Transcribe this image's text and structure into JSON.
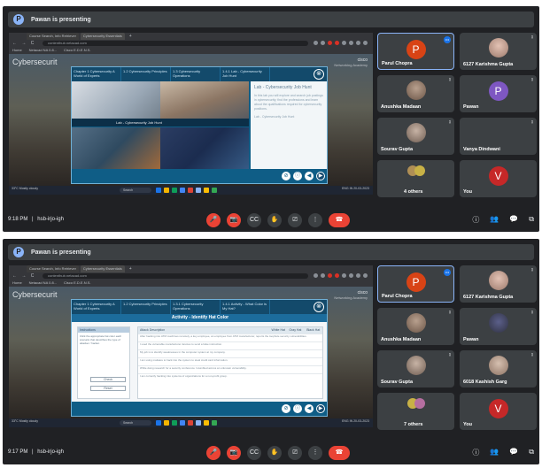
{
  "screens": [
    {
      "banner": {
        "icon": "P",
        "text": "Pawan is presenting"
      },
      "browser": {
        "tabs": [
          "Course Search, Info Retriever",
          "Cybersecurity Essentials"
        ],
        "new_tab": "+",
        "nav": "← → C",
        "address": "contenthub.netacad.com",
        "bookmarks": [
          "Home",
          "Netacad NA 0.8...",
          "Cisco E.D.E.N.S."
        ]
      },
      "site": {
        "title": "Cybersecurit",
        "cisco": "cisco",
        "cisco_sub": "Networking Academy"
      },
      "modal": {
        "chapters": [
          "Chapter 1\nCybersecurity A World of Experts",
          "1.2\nCybersecurity Principles",
          "1.3 Cybersecurity Operations",
          "1.4.1\nLab - Cybersecurity Job Hunt"
        ],
        "close": "⊗",
        "lab_strip": "Lab - Cybersecurity Job Hunt",
        "lab_title": "Lab - Cybersecurity Job Hunt",
        "lab_text": "In this lab you will explore and search job postings in cybersecurity; find the professions and learn about the qualifications required for cybersecurity positions.",
        "lab_link": "Lab - Cybersecurity Job Hunt",
        "footer_buttons": [
          "⊘",
          "ⓘ",
          "◀",
          "▶"
        ]
      },
      "taskbar": {
        "left": "33°C\nMostly cloudy",
        "search": "Search",
        "right": "ENG IN\n20-03-2023"
      },
      "participants": [
        {
          "name": "Parul Chopra",
          "letter": "P",
          "color": "#d84315",
          "type": "letter",
          "speaking": true
        },
        {
          "name": "6127 Karishma Gupta",
          "color": "#c9a69a",
          "type": "photo"
        },
        {
          "name": "Anushka Madaan",
          "color": "#8f7b6b",
          "type": "photo"
        },
        {
          "name": "Pawan",
          "letter": "P",
          "color": "#7e57c2",
          "type": "letter"
        },
        {
          "name": "Sourav Gupta",
          "color": "#a88f7e",
          "type": "photo"
        },
        {
          "name": "Vanya Dindwani",
          "color": "#3c4043",
          "type": "blank"
        },
        {
          "name": "4 others",
          "color": "#b08f55",
          "type": "others"
        },
        {
          "name": "You",
          "letter": "V",
          "color": "#c62828",
          "type": "letter"
        }
      ],
      "bottom": {
        "time": "9:18 PM",
        "separator": "|",
        "code": "hsb-irjo-igh"
      }
    },
    {
      "banner": {
        "icon": "P",
        "text": "Pawan is presenting"
      },
      "browser": {
        "tabs": [
          "Course Search, Info Retriever",
          "Cybersecurity Essentials"
        ],
        "new_tab": "+",
        "nav": "← → C",
        "address": "contenthub.netacad.com",
        "bookmarks": [
          "Home",
          "Netacad NA 0.8...",
          "Cisco E.D.E.N.S."
        ]
      },
      "site": {
        "title": "Cybersecurit",
        "cisco": "cisco",
        "cisco_sub": "Networking Academy"
      },
      "modal": {
        "chapters": [
          "Chapter 1\nCybersecurity A World of Experts",
          "1.2\nCybersecurity Principles",
          "1.3.1\nCybersecurity Operations",
          "1.4.1\nActivity - What Color is My Hat?"
        ],
        "close": "⊗",
        "activity_title": "Activity - Identify Hat Color",
        "instr_head": "Instructions",
        "instr_text": "Click the appropriate hat color each scenario that describes the type of attacker / hacker.",
        "left_buttons": [
          "Check",
          "Reset"
        ],
        "table_headers": [
          "Attack Description",
          "White Hat",
          "Gray Hat",
          "Black Hat"
        ],
        "table_rows": [
          "After hacking into ATM machines remotely, a key employee, an employee from ATM manufacturer, reports the loophole security vulnerabilities.",
          "I used the vulnerable manufacturer devices to send a false instruction.",
          "My job is to identify weaknesses in the computer system at my company.",
          "I am using malware to hack into the system to steal credit card information.",
          "While doing research for a security conference I stumbled across an unknown vulnerability.",
          "I am currently hacking into systems of organizations for a non-profit group."
        ],
        "footer_buttons": [
          "⊘",
          "ⓘ",
          "◀",
          "▶"
        ]
      },
      "taskbar": {
        "left": "33°C\nMostly cloudy",
        "search": "Search",
        "right": "ENG IN\n20-03-2023"
      },
      "participants": [
        {
          "name": "Parul Chopra",
          "letter": "P",
          "color": "#d84315",
          "type": "letter",
          "speaking": true
        },
        {
          "name": "6127 Karishma Gupta",
          "color": "#c9a69a",
          "type": "photo"
        },
        {
          "name": "Anushka Madaan",
          "color": "#8f7b6b",
          "type": "photo"
        },
        {
          "name": "Pawan",
          "color": "#5f6368",
          "type": "photo"
        },
        {
          "name": "Sourav Gupta",
          "color": "#a88f7e",
          "type": "photo"
        },
        {
          "name": "6018 Kashish Garg",
          "color": "#b59a8c",
          "type": "photo"
        },
        {
          "name": "7 others",
          "color": "#b56ea0",
          "type": "others"
        },
        {
          "name": "You",
          "letter": "V",
          "color": "#c62828",
          "type": "letter"
        }
      ],
      "bottom": {
        "time": "9:17 PM",
        "separator": "|",
        "code": "hsb-irjo-igh"
      }
    }
  ],
  "controls": [
    "🎤",
    "📷",
    "CC",
    "✋",
    "⎚",
    "⋮",
    "☎"
  ],
  "right_controls": [
    "ⓘ",
    "👥",
    "💬",
    "⧉"
  ],
  "colors": {
    "meet_bg": "#202124",
    "tile_bg": "#3c4043",
    "danger": "#ea4335",
    "speaking": "#8ab4f8"
  }
}
